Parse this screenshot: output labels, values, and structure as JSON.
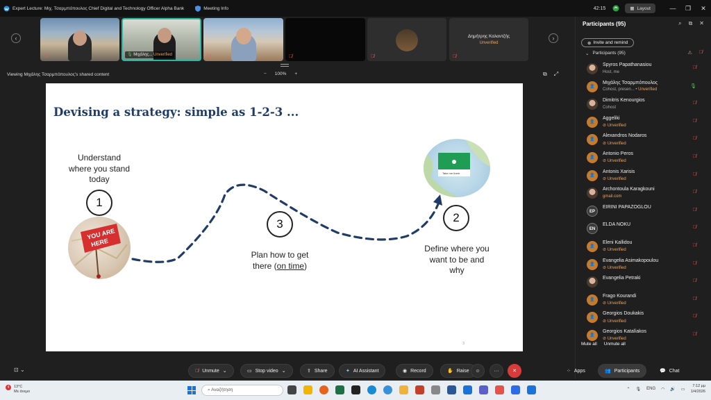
{
  "titlebar": {
    "title": "Expert Lecture: Μιχ. Τσαρμπόπουλος Chief Digital and Technology Officer Alpha Bank",
    "meeting_info": "Meeting Info",
    "clock": "42:15",
    "layout": "Layout"
  },
  "strip": {
    "tiles": [
      {
        "name": "",
        "muted": true
      },
      {
        "name": "Μιχάλης...",
        "unverified": "Unverified",
        "active": true
      },
      {
        "name": "",
        "muted": true
      },
      {
        "name": "",
        "muted": true
      },
      {
        "name": "",
        "muted": true
      },
      {
        "name": "Δημήτρης Καλαντζής",
        "unverified": "Unverified"
      }
    ]
  },
  "sharebar": {
    "label": "Viewing Μιχάλης Τσαρμπόπουλος's shared content",
    "zoom_out": "−",
    "zoom": "100%",
    "zoom_in": "+"
  },
  "slide": {
    "title": "Devising a strategy: simple as 1-2-3 ...",
    "step1_text": "Understand where you stand today",
    "step1_num": "1",
    "step2_text": "Define where you want to be and why",
    "step2_num": "2",
    "step3_text_a": "Plan how to get there (",
    "step3_text_u": "on time",
    "step3_text_b": ")",
    "step3_num": "3",
    "badge_line1": "YOU ARE",
    "badge_line2": "HERE",
    "map_popup": "Take me there",
    "page": "3",
    "colors": {
      "title": "#1f3b66",
      "path": "#1f3b66"
    }
  },
  "panel": {
    "title": "Participants (95)",
    "invite": "Invite and remind",
    "group": "Participants (95)",
    "participants": [
      {
        "name": "Spyros Papathanasiou",
        "sub": "Host, me",
        "subtype": "plain",
        "avatar": "photo",
        "mic": "muted"
      },
      {
        "name": "Μιχάλης Τσαρμπόπουλος",
        "sub": "Cohost, presen...",
        "sub2": "Unverified",
        "subtype": "plain",
        "avatar": "generic",
        "mic": "on"
      },
      {
        "name": "Dimitris Kenourgios",
        "sub": "Cohost",
        "subtype": "plain",
        "avatar": "photo",
        "mic": "muted"
      },
      {
        "name": "Aggeliki",
        "sub": "Unverified",
        "subtype": "unv",
        "avatar": "generic",
        "mic": "muted"
      },
      {
        "name": "Alexandros Nodaros",
        "sub": "Unverified",
        "subtype": "unv",
        "avatar": "generic",
        "mic": "muted"
      },
      {
        "name": "Antonio Peros",
        "sub": "Unverified",
        "subtype": "unv",
        "avatar": "generic",
        "mic": "muted"
      },
      {
        "name": "Antonis Xarisis",
        "sub": "Unverified",
        "subtype": "unv",
        "avatar": "generic",
        "mic": "muted"
      },
      {
        "name": "Archontoula Karagkouni",
        "sub": "gmail.com",
        "subtype": "mail",
        "avatar": "photo",
        "mic": "muted"
      },
      {
        "name": "EIRINI PAPAZOGLOU",
        "sub": "",
        "subtype": "plain",
        "avatar": "EP",
        "mic": "muted"
      },
      {
        "name": "ELDA NOKU",
        "sub": "",
        "subtype": "plain",
        "avatar": "EN",
        "mic": "muted"
      },
      {
        "name": "Eleni Kallidou",
        "sub": "Unverified",
        "subtype": "unv",
        "avatar": "generic",
        "mic": "muted"
      },
      {
        "name": "Evangelia Asimakopoulou",
        "sub": "Unverified",
        "subtype": "unv",
        "avatar": "generic",
        "mic": "muted"
      },
      {
        "name": "Evangelia Petraki",
        "sub": "",
        "subtype": "plain",
        "avatar": "photo",
        "mic": "muted"
      },
      {
        "name": "Frago Kourandi",
        "sub": "Unverified",
        "subtype": "unv",
        "avatar": "generic",
        "mic": "muted"
      },
      {
        "name": "Georgios Doukakis",
        "sub": "Unverified",
        "subtype": "unv",
        "avatar": "generic",
        "mic": "muted"
      },
      {
        "name": "Georgios Katalíakos",
        "sub": "Unverified",
        "subtype": "unv",
        "avatar": "generic",
        "mic": "muted"
      }
    ],
    "mute_all": "Mute all",
    "unmute_all": "Unmute all"
  },
  "toolbar": {
    "unmute": "Unmute",
    "stop_video": "Stop video",
    "share": "Share",
    "ai_assistant": "AI Assistant",
    "record": "Record",
    "raise": "Raise",
    "more": "···",
    "apps": "Apps",
    "participants": "Participants",
    "chat": "Chat"
  },
  "taskbar": {
    "temp": "13°C",
    "weather": "Με άνεμο",
    "weather_badge": "4",
    "search_placeholder": "Αναζήτηση",
    "lang": "ENG",
    "time": "7:12 μμ",
    "date": "1/4/2026"
  }
}
